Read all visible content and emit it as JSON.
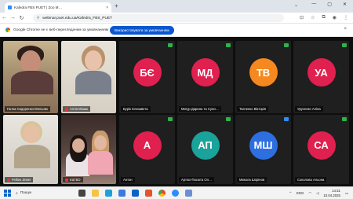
{
  "browser": {
    "tab_title": "Kafedra FBS PUET | Zoo M…",
    "tab_close": "×",
    "new_tab": "+",
    "url": "webinar.puet.edu.ua/Kafedra_FBS_PUET",
    "window_controls": [
      "—",
      "▢",
      "✕"
    ]
  },
  "infobar": {
    "message": "Google Chrome не є веб-переглядачем за умовчанням",
    "button_label": "Використовувати за умовчанням",
    "close": "×"
  },
  "meeting": {
    "participants": [
      {
        "name": "Ганна Сидоренко-Мельник",
        "type": "video"
      },
      {
        "name": "Алла Мішак",
        "type": "video"
      },
      {
        "initials": "БЄ",
        "name": "Бурік Єлизавета",
        "color": "#e0204f"
      },
      {
        "initials": "МД",
        "name": "Мигур Дарина та Сули…",
        "color": "#e0204f"
      },
      {
        "initials": "ТВ",
        "name": "Ткаченко Вікторія",
        "color": "#f5891f"
      },
      {
        "initials": "УА",
        "name": "Урусенко Аліна",
        "color": "#e0204f"
      },
      {
        "name": "Fellow Jitster",
        "type": "video"
      },
      {
        "name": "Kaf BO",
        "type": "video"
      },
      {
        "initials": "А",
        "name": "Антон",
        "color": "#e0204f"
      },
      {
        "initials": "АП",
        "name": "Артюх-Пасюта Ол…",
        "color": "#1aa39a"
      },
      {
        "initials": "МШ",
        "name": "Микола Шорінов",
        "color": "#2d6fe0"
      },
      {
        "initials": "СА",
        "name": "Соколова Альона",
        "color": "#e0204f"
      }
    ]
  },
  "taskbar": {
    "search_label": "Пошук",
    "language": "ENG",
    "time": "14:31",
    "date": "10.04.2025"
  },
  "colors": {
    "tile_bg": "#1f1f1f",
    "accent_blue": "#0b57d0",
    "active_green": "#2fb24c"
  }
}
